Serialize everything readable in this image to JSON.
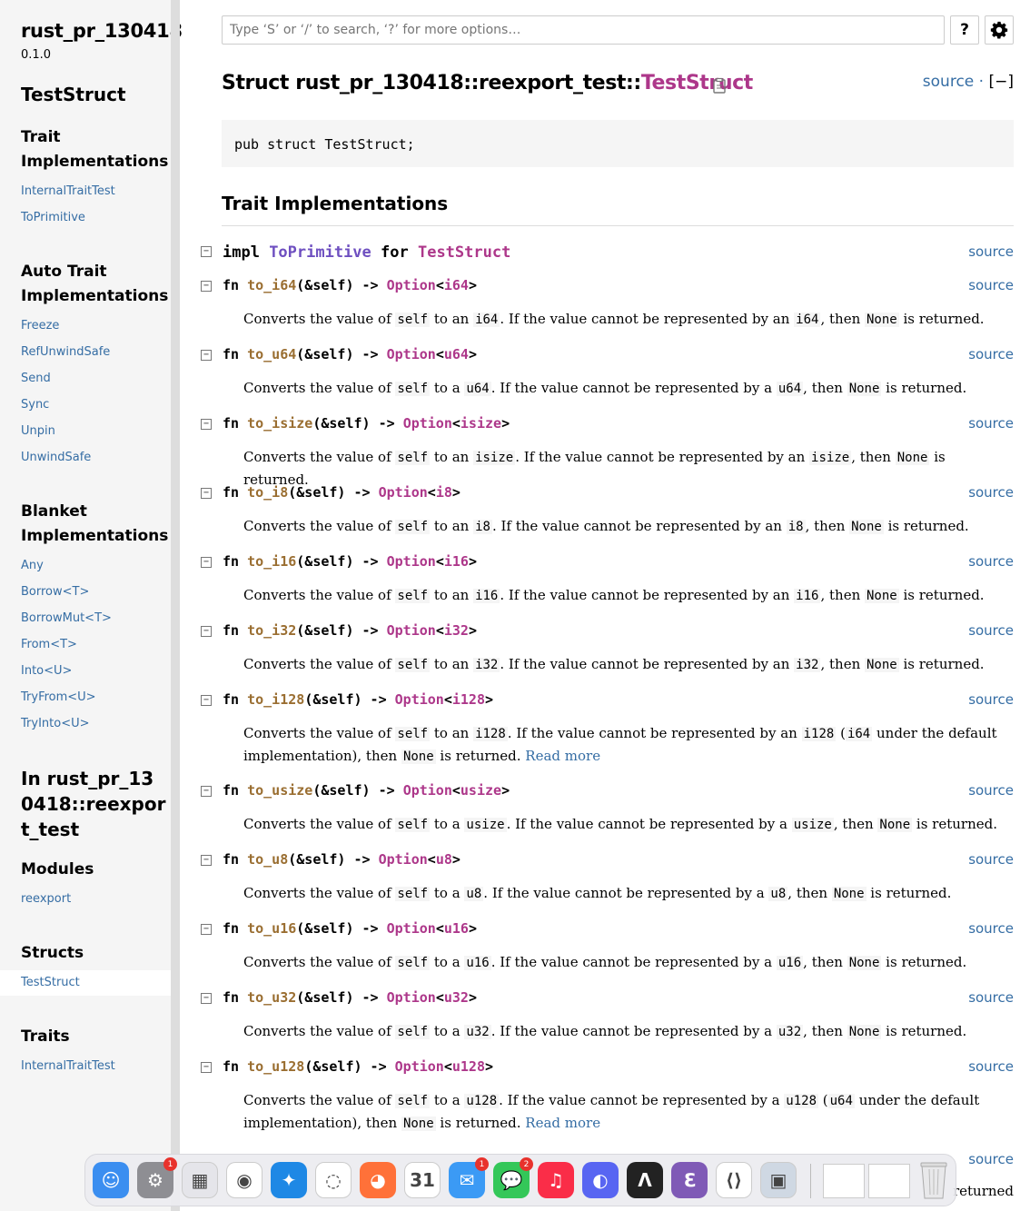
{
  "sidebar": {
    "crate_name": "rust_pr_130418",
    "crate_version": "0.1.0",
    "item_title": "TestStruct",
    "trait_impls_heading": "Trait Implementations",
    "trait_impls": [
      "InternalTraitTest",
      "ToPrimitive"
    ],
    "auto_trait_heading": "Auto Trait Implementations",
    "auto_traits": [
      "Freeze",
      "RefUnwindSafe",
      "Send",
      "Sync",
      "Unpin",
      "UnwindSafe"
    ],
    "blanket_heading": "Blanket Implementations",
    "blanket": [
      "Any",
      "Borrow<T>",
      "BorrowMut<T>",
      "From<T>",
      "Into<U>",
      "TryFrom<U>",
      "TryInto<U>"
    ],
    "in_module_heading": "In rust_pr_130418::reexport_test",
    "modules_heading": "Modules",
    "modules": [
      "reexport"
    ],
    "structs_heading": "Structs",
    "structs": [
      "TestStruct"
    ],
    "traits_heading": "Traits",
    "traits": [
      "InternalTraitTest"
    ]
  },
  "search": {
    "placeholder": "Type ‘S’ or ‘/’ to search, ‘?’ for more options…"
  },
  "help_label": "?",
  "main": {
    "title_prefix": "Struct rust_pr_130418::reexport_test::",
    "title_name": "TestStruct",
    "source_label": "source",
    "source_sep": " · ",
    "collapse_label": "[−]",
    "declaration": "pub struct TestStruct;",
    "section_heading": "Trait Implementations",
    "impl_sig": {
      "kw": "impl ",
      "trait": "ToPrimitive",
      "for": " for ",
      "type": "TestStruct"
    },
    "source_link": "source",
    "read_more": "Read more",
    "fns": [
      {
        "name": "to_i64",
        "ret": "i64",
        "article": "an"
      },
      {
        "name": "to_u64",
        "ret": "u64",
        "article": "a"
      },
      {
        "name": "to_isize",
        "ret": "isize",
        "article": "an"
      },
      {
        "name": "to_i8",
        "ret": "i8",
        "article": "an"
      },
      {
        "name": "to_i16",
        "ret": "i16",
        "article": "an"
      },
      {
        "name": "to_i32",
        "ret": "i32",
        "article": "an"
      },
      {
        "name": "to_i128",
        "ret": "i128",
        "article": "an",
        "default_type": "i64"
      },
      {
        "name": "to_usize",
        "ret": "usize",
        "article": "a"
      },
      {
        "name": "to_u8",
        "ret": "u8",
        "article": "a"
      },
      {
        "name": "to_u16",
        "ret": "u16",
        "article": "a"
      },
      {
        "name": "to_u32",
        "ret": "u32",
        "article": "a"
      },
      {
        "name": "to_u128",
        "ret": "u128",
        "article": "a",
        "default_type": "u64"
      }
    ],
    "partial_source_label": "source",
    "partial_text": "returned"
  },
  "dock": {
    "apps": [
      {
        "name": "finder",
        "color": "#3b8ef0",
        "glyph": "☺"
      },
      {
        "name": "system-settings",
        "color": "#8e8e93",
        "glyph": "⚙",
        "badge": "1"
      },
      {
        "name": "launchpad",
        "color": "#e5e5ea",
        "glyph": "▦"
      },
      {
        "name": "chrome",
        "color": "#ffffff",
        "glyph": "◉"
      },
      {
        "name": "safari",
        "color": "#1e88e5",
        "glyph": "✦"
      },
      {
        "name": "sync-app",
        "color": "#ffffff",
        "glyph": "◌"
      },
      {
        "name": "firefox",
        "color": "#ff7139",
        "glyph": "◕"
      },
      {
        "name": "calendar",
        "color": "#ffffff",
        "glyph": "31"
      },
      {
        "name": "mail",
        "color": "#3b9af5",
        "glyph": "✉",
        "badge": "1"
      },
      {
        "name": "messages",
        "color": "#34c759",
        "glyph": "💬",
        "badge": "2"
      },
      {
        "name": "music",
        "color": "#fa2d48",
        "glyph": "♫"
      },
      {
        "name": "discord",
        "color": "#5865f2",
        "glyph": "◐"
      },
      {
        "name": "terminal-app",
        "color": "#222222",
        "glyph": "Λ"
      },
      {
        "name": "emacs",
        "color": "#7f5ab6",
        "glyph": "ℇ"
      },
      {
        "name": "vscode",
        "color": "#ffffff",
        "glyph": "⟨⟩"
      },
      {
        "name": "preview",
        "color": "#cfd8e3",
        "glyph": "▣"
      }
    ]
  }
}
